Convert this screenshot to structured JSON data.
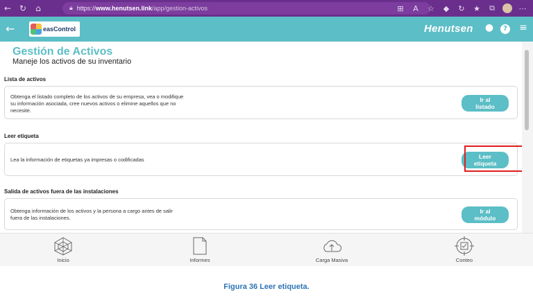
{
  "browser": {
    "url_prefix": "https://",
    "url_host": "www.henutsen.link",
    "url_path": "/app/gestion-activos"
  },
  "header": {
    "logo_text": "easControl",
    "brand": "Henutsen"
  },
  "page": {
    "title": "Gestión de Activos",
    "subtitle": "Maneje los activos de su inventario"
  },
  "sections": [
    {
      "title": "Lista de activos",
      "description": "Obtenga el listado completo de los activos de su empresa, vea o modifique su información asociada, cree nuevos activos o elimine aquellos que no necesite.",
      "button_line1": "Ir al",
      "button_line2": "listado"
    },
    {
      "title": "Leer etiqueta",
      "description": "Lea la información de etiquetas ya impresas o codificadas",
      "button_line1": "Leer",
      "button_line2": "etiqueta"
    },
    {
      "title": "Salida de activos fuera de las instalaciones",
      "description": "Obtenga información de los activos y la persona a cargo antes de salir fuera de las instalaciones.",
      "button_line1": "Ir al",
      "button_line2": "módulo"
    }
  ],
  "bottom_nav": [
    {
      "label": "Inicio",
      "icon": "radar-icon"
    },
    {
      "label": "Informes",
      "icon": "document-icon"
    },
    {
      "label": "Carga Masiva",
      "icon": "cloud-upload-icon"
    },
    {
      "label": "Conteo",
      "icon": "target-check-icon"
    }
  ],
  "caption": "Figura 36 Leer etiqueta.",
  "colors": {
    "accent": "#5cbec6",
    "browser": "#6a2e8c",
    "highlight": "#e01c1c",
    "caption": "#2e74b5"
  }
}
